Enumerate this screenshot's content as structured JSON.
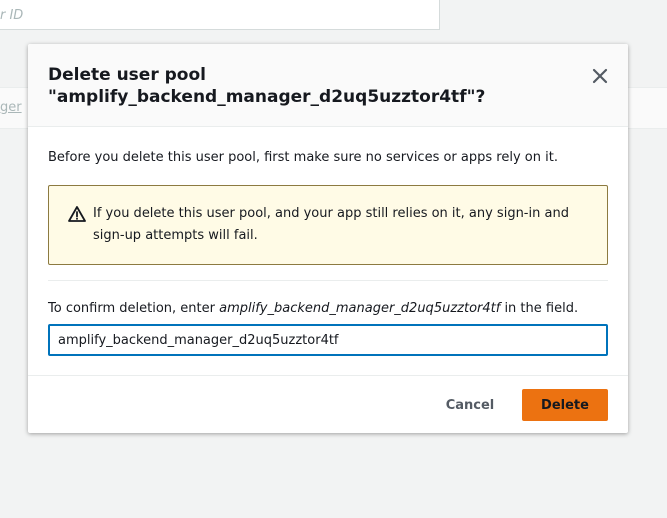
{
  "background": {
    "search_placeholder": "r ID",
    "link_text": "ger"
  },
  "modal": {
    "title_line1": "Delete user pool",
    "title_line2": "\"amplify_backend_manager_d2uq5uzztor4tf\"?",
    "intro": "Before you delete this user pool, first make sure no services or apps rely on it.",
    "warning": "If you delete this user pool, and your app still relies on it, any sign-in and sign-up attempts will fail.",
    "confirm_prefix": "To confirm deletion, enter ",
    "confirm_name": "amplify_backend_manager_d2uq5uzztor4tf",
    "confirm_suffix": " in the field.",
    "input_value": "amplify_backend_manager_d2uq5uzztor4tf",
    "cancel_label": "Cancel",
    "delete_label": "Delete"
  },
  "icons": {
    "close": "close-icon",
    "warning": "warning-icon"
  },
  "colors": {
    "accent": "#ec7211",
    "focus": "#0073bb",
    "warning_bg": "#fffbe6",
    "warning_border": "#8c7a40"
  }
}
